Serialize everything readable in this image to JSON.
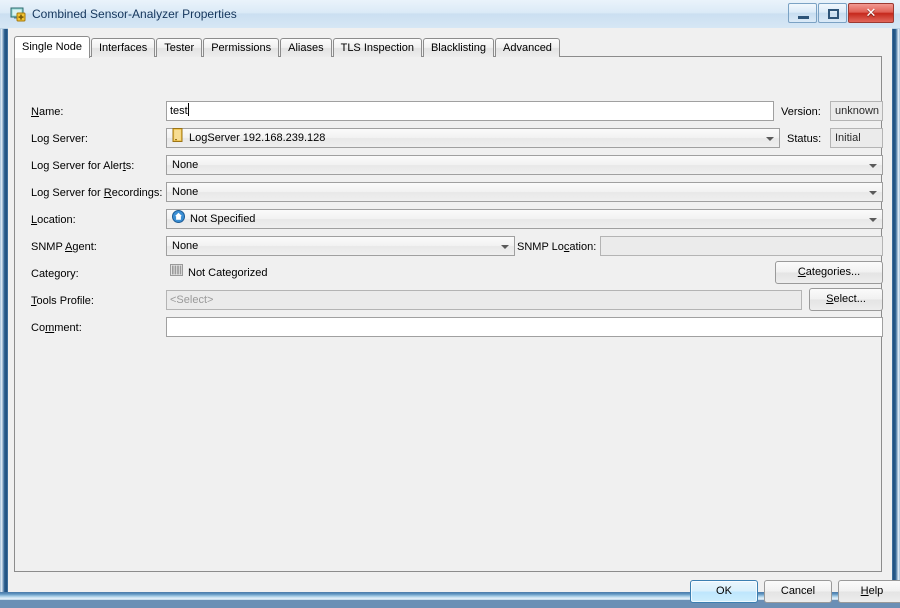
{
  "window": {
    "title": "Combined Sensor-Analyzer Properties",
    "icon": "app-icon",
    "minimize_label": "–",
    "maximize_label": "□",
    "close_label": "✕"
  },
  "tabs": [
    {
      "label": "Single Node",
      "active": true
    },
    {
      "label": "Interfaces",
      "active": false
    },
    {
      "label": "Tester",
      "active": false
    },
    {
      "label": "Permissions",
      "active": false
    },
    {
      "label": "Aliases",
      "active": false
    },
    {
      "label": "TLS Inspection",
      "active": false
    },
    {
      "label": "Blacklisting",
      "active": false
    },
    {
      "label": "Advanced",
      "active": false
    }
  ],
  "form": {
    "name": {
      "label_pre": "",
      "label_key": "N",
      "label_post": "ame:",
      "value": "test"
    },
    "version": {
      "label": "Version:",
      "value": "unknown"
    },
    "status": {
      "label": "Status:",
      "value": "Initial"
    },
    "log_server": {
      "label_pre": "Lo",
      "label_key": "g",
      "label_post": " Server:",
      "value": "LogServer 192.168.239.128",
      "icon": "server-icon"
    },
    "log_server_alerts": {
      "label_pre": "Log Server for Aler",
      "label_key": "t",
      "label_post": "s:",
      "value": "None"
    },
    "log_server_recordings": {
      "label_pre": "Log Server for ",
      "label_key": "R",
      "label_post": "ecordings:",
      "value": "None"
    },
    "location": {
      "label_pre": "",
      "label_key": "L",
      "label_post": "ocation:",
      "value": "Not Specified",
      "icon": "home-circle-icon"
    },
    "snmp_agent": {
      "label_pre": "SNMP ",
      "label_key": "A",
      "label_post": "gent:",
      "value": "None"
    },
    "snmp_location": {
      "label_pre": "SNMP Lo",
      "label_key": "c",
      "label_post": "ation:",
      "value": "",
      "placeholder": ""
    },
    "category": {
      "label": "Category:",
      "value": "Not Categorized",
      "icon": "categories-bars-icon",
      "button_pre": "",
      "button_key": "C",
      "button_post": "ategories..."
    },
    "tools_profile": {
      "label_pre": "",
      "label_key": "T",
      "label_post": "ools Profile:",
      "value": "<Select>",
      "button_pre": "",
      "button_key": "S",
      "button_post": "elect..."
    },
    "comment": {
      "label_pre": "Co",
      "label_key": "m",
      "label_post": "ment:",
      "value": ""
    }
  },
  "buttons": {
    "ok": "OK",
    "cancel": "Cancel",
    "help_pre": "",
    "help_key": "H",
    "help_post": "elp"
  },
  "colors": {
    "accent": "#3c7fb1",
    "close_red": "#c5281c",
    "server_icon": "#e8b53a",
    "location_icon": "#2d7fc4",
    "panel_bg": "#f0f0f0"
  }
}
